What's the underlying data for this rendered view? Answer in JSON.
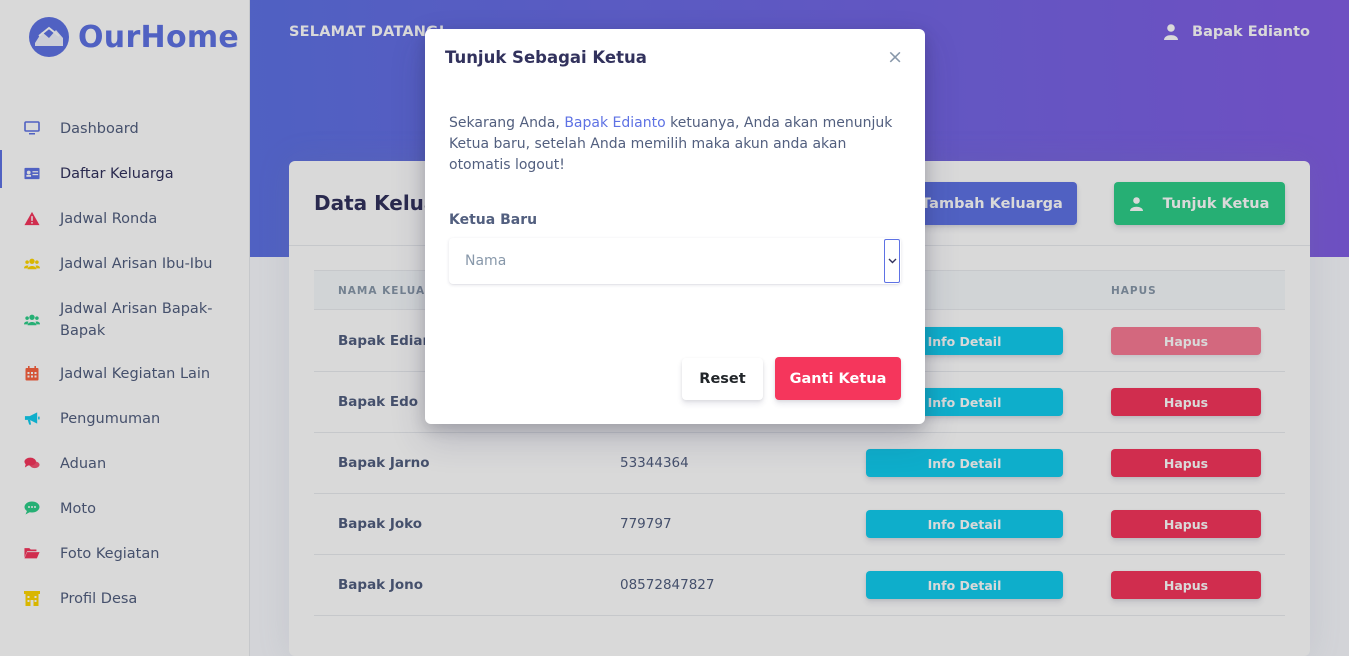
{
  "brand": {
    "name": "OurHome"
  },
  "sidebar": {
    "items": [
      {
        "label": "Dashboard",
        "icon": "monitor-icon",
        "color": "#5e72e4"
      },
      {
        "label": "Daftar Keluarga",
        "icon": "id-card-icon",
        "color": "#5e72e4",
        "active": true
      },
      {
        "label": "Jadwal Ronda",
        "icon": "warning-icon",
        "color": "#f5365c"
      },
      {
        "label": "Jadwal Arisan Ibu-Ibu",
        "icon": "users-icon",
        "color": "#ffd600"
      },
      {
        "label": "Jadwal Arisan Bapak-Bapak",
        "icon": "users-icon",
        "color": "#2dce89"
      },
      {
        "label": "Jadwal Kegiatan Lain",
        "icon": "calendar-icon",
        "color": "#fb6340"
      },
      {
        "label": "Pengumuman",
        "icon": "bullhorn-icon",
        "color": "#11cdef"
      },
      {
        "label": "Aduan",
        "icon": "comments-icon",
        "color": "#f5365c"
      },
      {
        "label": "Moto",
        "icon": "comment-dots-icon",
        "color": "#2dce89"
      },
      {
        "label": "Foto Kegiatan",
        "icon": "folder-open-icon",
        "color": "#f5365c"
      },
      {
        "label": "Profil Desa",
        "icon": "building-icon",
        "color": "#ffd600"
      }
    ]
  },
  "header": {
    "welcome": "SELAMAT DATANG!",
    "user_name": "Bapak Edianto"
  },
  "card": {
    "title": "Data Keluar",
    "add_button": "Tambah Keluarga",
    "leader_button": "Tunjuk Ketua",
    "columns": [
      "NAMA KELUARG",
      "HAPUS"
    ],
    "rows": [
      {
        "name": "Bapak Edianto",
        "phone": "",
        "info": "Info Detail",
        "delete": "Hapus",
        "delete_disabled": true
      },
      {
        "name": "Bapak Edo",
        "phone": "",
        "info": "Info Detail",
        "delete": "Hapus"
      },
      {
        "name": "Bapak Jarno",
        "phone": "53344364",
        "info": "Info Detail",
        "delete": "Hapus"
      },
      {
        "name": "Bapak Joko",
        "phone": "779797",
        "info": "Info Detail",
        "delete": "Hapus"
      },
      {
        "name": "Bapak Jono",
        "phone": "08572847827",
        "info": "Info Detail",
        "delete": "Hapus"
      }
    ]
  },
  "modal": {
    "title": "Tunjuk Sebagai Ketua",
    "close": "×",
    "text_before": "Sekarang Anda, ",
    "text_highlight": "Bapak Edianto",
    "text_after": " ketuanya, Anda akan menunjuk Ketua baru, setelah Anda memilih maka akun anda akan otomatis logout!",
    "field_label": "Ketua Baru",
    "select_placeholder": "Nama",
    "reset_button": "Reset",
    "submit_button": "Ganti Ketua"
  },
  "colors": {
    "primary": "#5e72e4",
    "success": "#2dce89",
    "danger": "#f5365c",
    "info": "#11cdef"
  }
}
